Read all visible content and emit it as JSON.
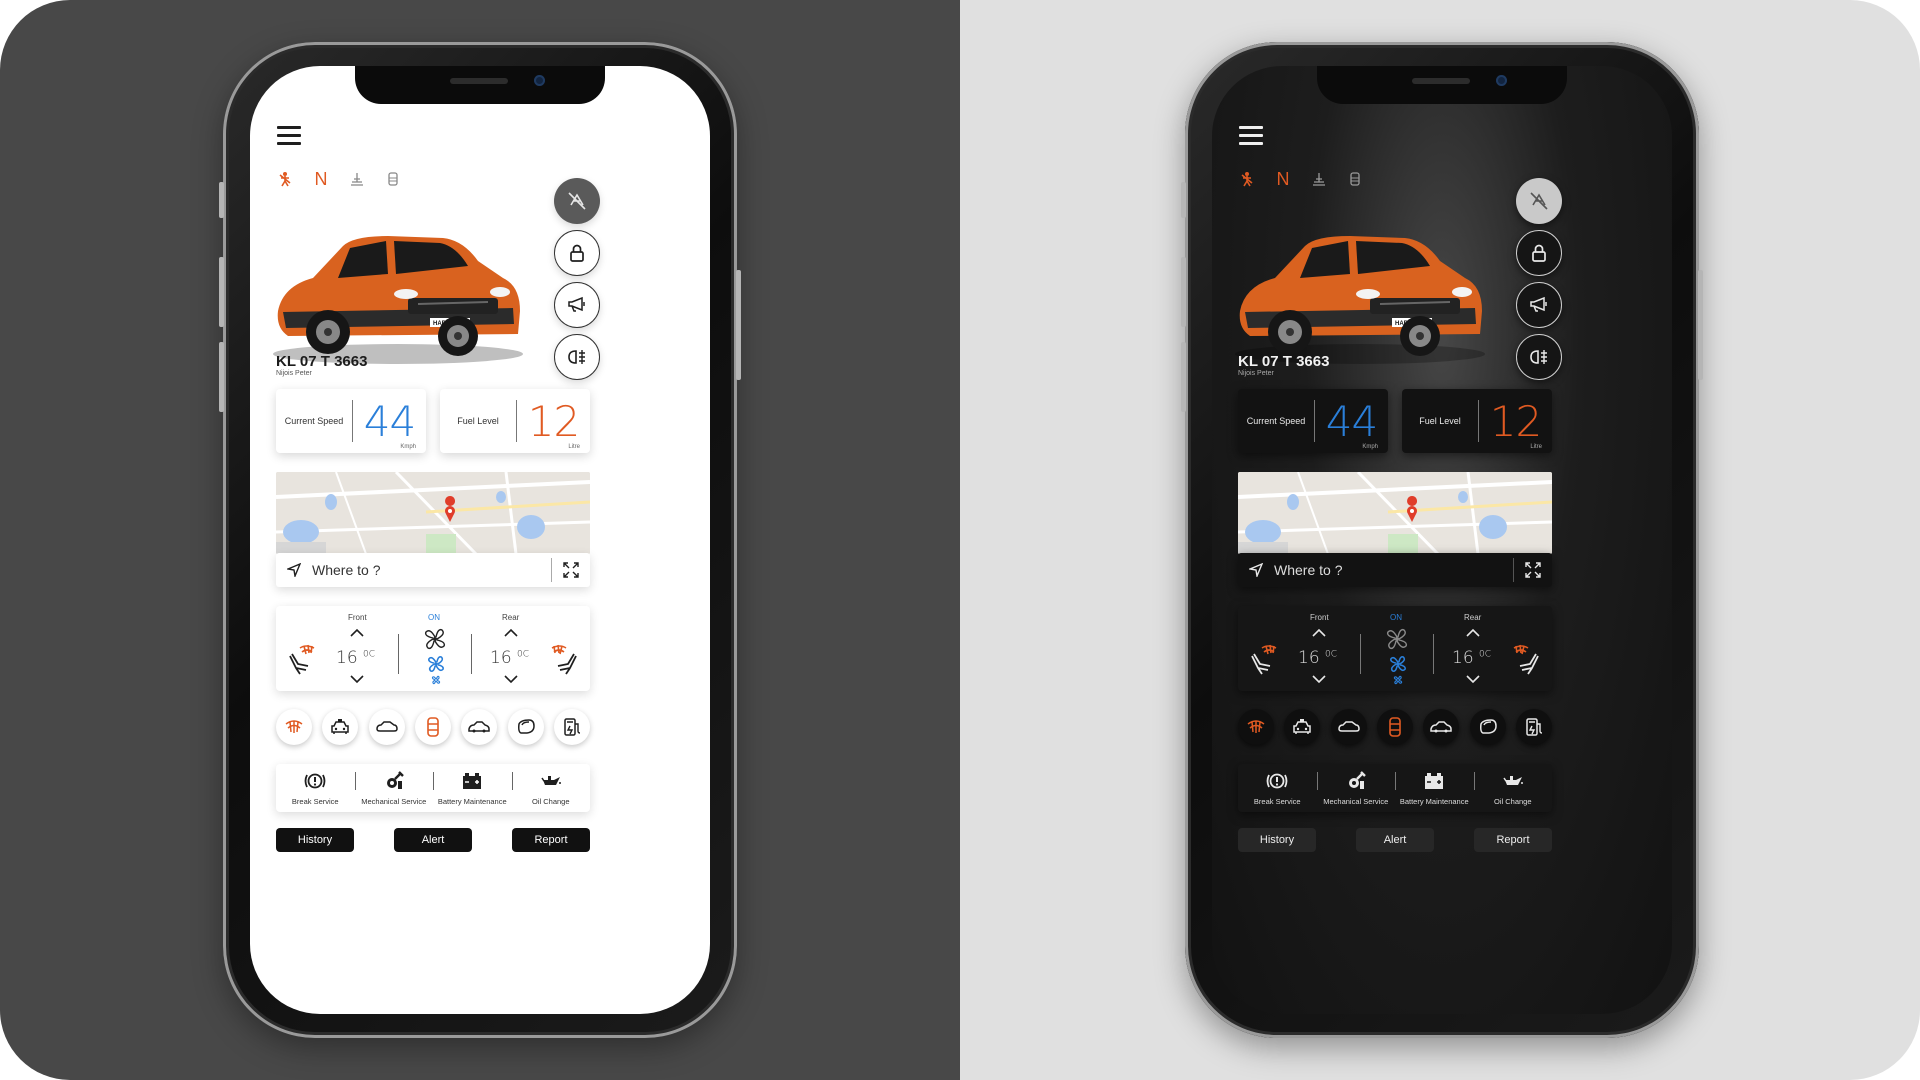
{
  "colors": {
    "accent_orange": "#e05a22",
    "accent_blue": "#2a7fd9",
    "bg_left": "#484848",
    "bg_right": "#e0e0e0"
  },
  "phones": [
    {
      "theme": "light",
      "status_icons": [
        "seatbelt-icon",
        "neutral-gear-icon",
        "handbrake-icon",
        "seat-icon"
      ],
      "gear_letter": "N",
      "controls": [
        "engine-off-icon",
        "lock-icon",
        "horn-icon",
        "headlight-icon"
      ],
      "plate": "KL 07  T 3663",
      "owner": "Nijois Peter",
      "speed": {
        "label": "Current Speed",
        "value": "44",
        "unit": "Kmph"
      },
      "fuel": {
        "label": "Fuel Level",
        "value": "12",
        "unit": "Litre"
      },
      "search": {
        "placeholder": "Where to ?"
      },
      "climate": {
        "front_label": "Front",
        "on_label": "ON",
        "rear_label": "Rear",
        "front_temp": "16",
        "rear_temp": "16",
        "temp_unit": "0C"
      },
      "quick_icons": [
        "rear-defrost-icon",
        "taxi-icon",
        "car-top-icon",
        "car-seat-icon",
        "car-side-icon",
        "mirror-icon",
        "fuel-door-icon"
      ],
      "service": [
        {
          "label": "Break Service",
          "icon": "brake-warning-icon"
        },
        {
          "label": "Mechanical Service",
          "icon": "wrench-gear-icon"
        },
        {
          "label": "Battery Maintenance",
          "icon": "battery-icon"
        },
        {
          "label": "Oil Change",
          "icon": "oil-can-icon"
        }
      ],
      "buttons": {
        "history": "History",
        "alert": "Alert",
        "report": "Report"
      }
    },
    {
      "theme": "dark",
      "status_icons": [
        "seatbelt-icon",
        "neutral-gear-icon",
        "handbrake-icon",
        "seat-icon"
      ],
      "gear_letter": "N",
      "controls": [
        "engine-off-icon",
        "lock-icon",
        "horn-icon",
        "headlight-icon"
      ],
      "plate": "KL 07  T 3663",
      "owner": "Nijois Peter",
      "speed": {
        "label": "Current Speed",
        "value": "44",
        "unit": "Kmph"
      },
      "fuel": {
        "label": "Fuel Level",
        "value": "12",
        "unit": "Litre"
      },
      "search": {
        "placeholder": "Where to ?"
      },
      "climate": {
        "front_label": "Front",
        "on_label": "ON",
        "rear_label": "Rear",
        "front_temp": "16",
        "rear_temp": "16",
        "temp_unit": "0C"
      },
      "quick_icons": [
        "rear-defrost-icon",
        "taxi-icon",
        "car-top-icon",
        "car-seat-icon",
        "car-side-icon",
        "mirror-icon",
        "fuel-door-icon"
      ],
      "service": [
        {
          "label": "Break Service",
          "icon": "brake-warning-icon"
        },
        {
          "label": "Mechanical Service",
          "icon": "wrench-gear-icon"
        },
        {
          "label": "Battery Maintenance",
          "icon": "battery-icon"
        },
        {
          "label": "Oil Change",
          "icon": "oil-can-icon"
        }
      ],
      "buttons": {
        "history": "History",
        "alert": "Alert",
        "report": "Report"
      }
    }
  ]
}
